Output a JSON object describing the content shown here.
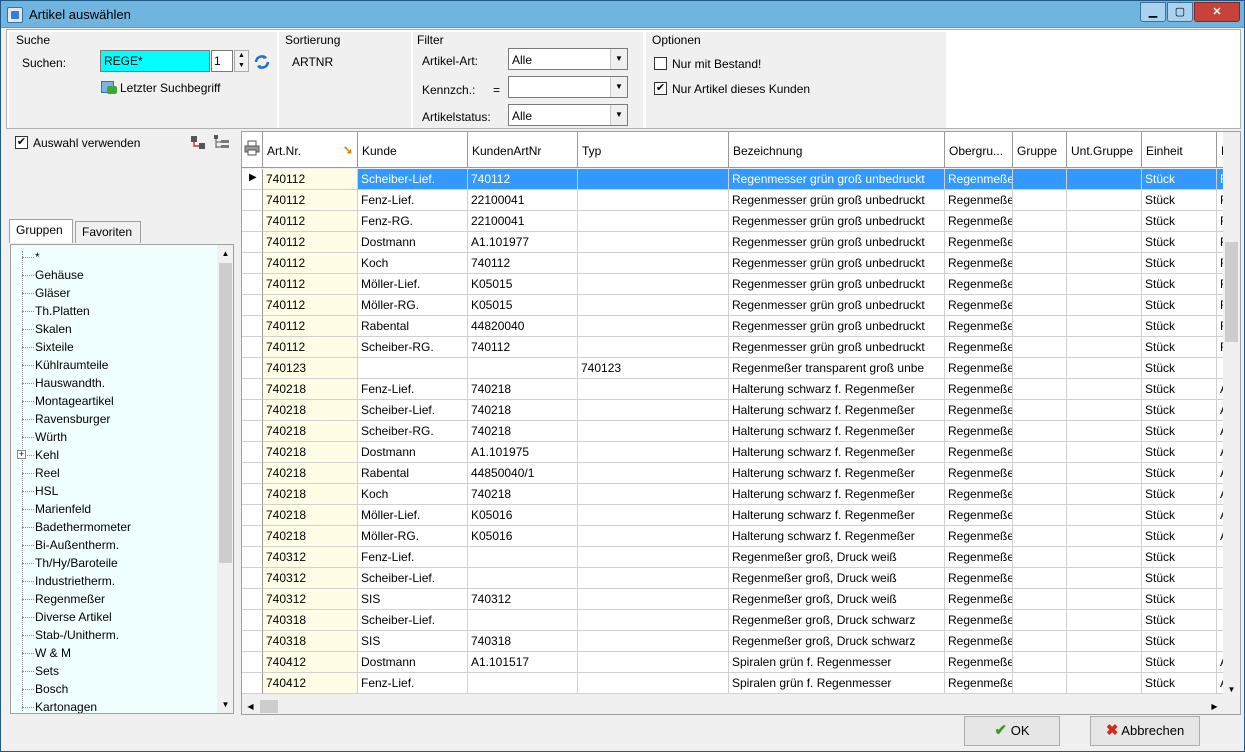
{
  "window": {
    "title": "Artikel auswählen",
    "min": "▁",
    "max": "▢",
    "close": "✕"
  },
  "search": {
    "group_label": "Suche",
    "label": "Suchen:",
    "value": "REGE*",
    "count": "1",
    "last_term": "Letzter Suchbegriff"
  },
  "sort": {
    "group_label": "Sortierung",
    "value": "ARTNR"
  },
  "filter": {
    "group_label": "Filter",
    "art_label": "Artikel-Art:",
    "art_value": "Alle",
    "kennz_label": "Kennzch.:",
    "kennz_op": "=",
    "kennz_value": "",
    "status_label": "Artikelstatus:",
    "status_value": "Alle"
  },
  "options": {
    "group_label": "Optionen",
    "bestand_label": "Nur mit Bestand!",
    "bestand_checked": false,
    "kunde_label": "Nur Artikel dieses Kunden",
    "kunde_checked": true
  },
  "left": {
    "use_selection_label": "Auswahl verwenden",
    "use_selection_checked": true,
    "tabs": [
      "Gruppen",
      "Favoriten"
    ],
    "groups": [
      "*",
      "Gehäuse",
      "Gläser",
      "Th.Platten",
      "Skalen",
      "Sixteile",
      "Kühlraumteile",
      "Hauswandth.",
      "Montageartikel",
      "Ravensburger",
      "Würth",
      "Kehl",
      "Reel",
      "HSL",
      "Marienfeld",
      "Badethermometer",
      "Bi-Außentherm.",
      "Th/Hy/Baroteile",
      "Industrietherm.",
      "Regenmeßer",
      "Diverse Artikel",
      "Stab-/Unitherm.",
      "W & M",
      "Sets",
      "Bosch",
      "Kartonagen"
    ]
  },
  "grid": {
    "columns": [
      "Art.Nr.",
      "Kunde",
      "KundenArtNr",
      "Typ",
      "Bezeichnung",
      "Obergru...",
      "Gruppe",
      "Unt.Gruppe",
      "Einheit",
      "F"
    ],
    "rows": [
      [
        "740112",
        "Scheiber-Lief.",
        "740112",
        "",
        "Regenmesser grün groß unbedruckt",
        "Regenmeße",
        "",
        "",
        "Stück",
        "F"
      ],
      [
        "740112",
        "Fenz-Lief.",
        "22100041",
        "",
        "Regenmesser grün groß unbedruckt",
        "Regenmeße",
        "",
        "",
        "Stück",
        "F"
      ],
      [
        "740112",
        "Fenz-RG.",
        "22100041",
        "",
        "Regenmesser grün groß unbedruckt",
        "Regenmeße",
        "",
        "",
        "Stück",
        "F"
      ],
      [
        "740112",
        "Dostmann",
        "A1.101977",
        "",
        "Regenmesser grün groß unbedruckt",
        "Regenmeße",
        "",
        "",
        "Stück",
        "F"
      ],
      [
        "740112",
        "Koch",
        "740112",
        "",
        "Regenmesser grün groß unbedruckt",
        "Regenmeße",
        "",
        "",
        "Stück",
        "F"
      ],
      [
        "740112",
        "Möller-Lief.",
        "K05015",
        "",
        "Regenmesser grün groß unbedruckt",
        "Regenmeße",
        "",
        "",
        "Stück",
        "F"
      ],
      [
        "740112",
        "Möller-RG.",
        "K05015",
        "",
        "Regenmesser grün groß unbedruckt",
        "Regenmeße",
        "",
        "",
        "Stück",
        "F"
      ],
      [
        "740112",
        "Rabental",
        "44820040",
        "",
        "Regenmesser grün groß unbedruckt",
        "Regenmeße",
        "",
        "",
        "Stück",
        "F"
      ],
      [
        "740112",
        "Scheiber-RG.",
        "740112",
        "",
        "Regenmesser grün groß unbedruckt",
        "Regenmeße",
        "",
        "",
        "Stück",
        "F"
      ],
      [
        "740123",
        "",
        "",
        "740123",
        "Regenmeßer transparent groß unbe",
        "Regenmeße",
        "",
        "",
        "Stück",
        ""
      ],
      [
        "740218",
        "Fenz-Lief.",
        "740218",
        "",
        "Halterung schwarz f. Regenmeßer",
        "Regenmeße",
        "",
        "",
        "Stück",
        "A"
      ],
      [
        "740218",
        "Scheiber-Lief.",
        "740218",
        "",
        "Halterung schwarz f. Regenmeßer",
        "Regenmeße",
        "",
        "",
        "Stück",
        "A"
      ],
      [
        "740218",
        "Scheiber-RG.",
        "740218",
        "",
        "Halterung schwarz f. Regenmeßer",
        "Regenmeße",
        "",
        "",
        "Stück",
        "A"
      ],
      [
        "740218",
        "Dostmann",
        "A1.101975",
        "",
        "Halterung schwarz f. Regenmeßer",
        "Regenmeße",
        "",
        "",
        "Stück",
        "A"
      ],
      [
        "740218",
        "Rabental",
        "44850040/1",
        "",
        "Halterung schwarz f. Regenmeßer",
        "Regenmeße",
        "",
        "",
        "Stück",
        "A"
      ],
      [
        "740218",
        "Koch",
        "740218",
        "",
        "Halterung schwarz f. Regenmeßer",
        "Regenmeße",
        "",
        "",
        "Stück",
        "A"
      ],
      [
        "740218",
        "Möller-Lief.",
        "K05016",
        "",
        "Halterung schwarz f. Regenmeßer",
        "Regenmeße",
        "",
        "",
        "Stück",
        "A"
      ],
      [
        "740218",
        "Möller-RG.",
        "K05016",
        "",
        "Halterung schwarz f. Regenmeßer",
        "Regenmeße",
        "",
        "",
        "Stück",
        "A"
      ],
      [
        "740312",
        "Fenz-Lief.",
        "",
        "",
        "Regenmeßer groß, Druck weiß",
        "Regenmeße",
        "",
        "",
        "Stück",
        ""
      ],
      [
        "740312",
        "Scheiber-Lief.",
        "",
        "",
        "Regenmeßer groß, Druck weiß",
        "Regenmeße",
        "",
        "",
        "Stück",
        ""
      ],
      [
        "740312",
        "SIS",
        "740312",
        "",
        "Regenmeßer groß, Druck weiß",
        "Regenmeße",
        "",
        "",
        "Stück",
        ""
      ],
      [
        "740318",
        "Scheiber-Lief.",
        "",
        "",
        "Regenmeßer groß, Druck schwarz",
        "Regenmeße",
        "",
        "",
        "Stück",
        ""
      ],
      [
        "740318",
        "SIS",
        "740318",
        "",
        "Regenmeßer groß, Druck schwarz",
        "Regenmeße",
        "",
        "",
        "Stück",
        ""
      ],
      [
        "740412",
        "Dostmann",
        "A1.101517",
        "",
        "Spiralen grün f. Regenmesser",
        "Regenmeße",
        "",
        "",
        "Stück",
        "A"
      ],
      [
        "740412",
        "Fenz-Lief.",
        "",
        "",
        "Spiralen grün f. Regenmesser",
        "Regenmeße",
        "",
        "",
        "Stück",
        "A"
      ]
    ]
  },
  "buttons": {
    "ok": "OK",
    "cancel": "Abbrechen"
  },
  "colors": {
    "selection": "#3399ff",
    "artnr_bg": "#fffde6",
    "tree_bg": "#f0ffff",
    "search_bg": "#00ffff"
  }
}
